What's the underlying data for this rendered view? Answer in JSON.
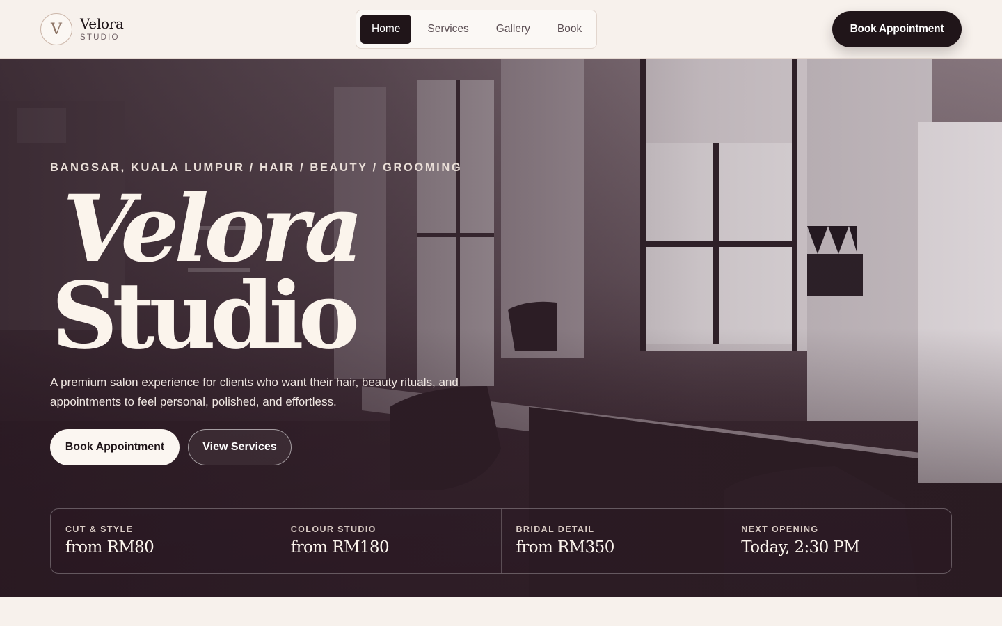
{
  "brand": {
    "mark": "V",
    "name": "Velora",
    "sub": "STUDIO"
  },
  "nav": {
    "items": [
      {
        "label": "Home",
        "active": true
      },
      {
        "label": "Services",
        "active": false
      },
      {
        "label": "Gallery",
        "active": false
      },
      {
        "label": "Book",
        "active": false
      }
    ]
  },
  "header": {
    "cta_label": "Book Appointment"
  },
  "hero": {
    "eyebrow": "BANGSAR, KUALA LUMPUR / HAIR / BEAUTY / GROOMING",
    "title_line1": "Velora",
    "title_line2": "Studio",
    "description": "A premium salon experience for clients who want their hair, beauty rituals, and appointments to feel personal, polished, and effortless.",
    "primary_cta": "Book Appointment",
    "secondary_cta": "View Services"
  },
  "stats": [
    {
      "label": "CUT & STYLE",
      "value": "from RM80"
    },
    {
      "label": "COLOUR STUDIO",
      "value": "from RM180"
    },
    {
      "label": "BRIDAL DETAIL",
      "value": "from RM350"
    },
    {
      "label": "NEXT OPENING",
      "value": "Today, 2:30 PM"
    }
  ],
  "colors": {
    "background": "#f7f1ec",
    "ink": "#201519",
    "hero_overlay": "#2c1c24",
    "cream": "#fbf4ec"
  }
}
